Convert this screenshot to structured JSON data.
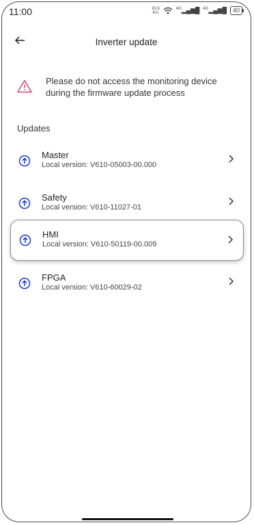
{
  "status_bar": {
    "time": "11:00",
    "net_speed_top": "30.6",
    "net_speed_bottom": "K/s",
    "signal1": "4G",
    "signal2": "4G",
    "battery": "40"
  },
  "header": {
    "title": "Inverter update",
    "back_icon": "arrow-left-icon"
  },
  "warning": {
    "icon": "warning-triangle-icon",
    "line1": "Please do not access the monitoring device",
    "line2": "during the firmware update process",
    "color": "#e0245e"
  },
  "updates": {
    "section_label": "Updates",
    "accent": "#1a3bd6",
    "items": [
      {
        "name": "Master",
        "version": "Local version: V610-05003-00.000"
      },
      {
        "name": "Safety",
        "version": "Local version: V610-11027-01"
      },
      {
        "name": "HMI",
        "version": "Local version: V610-50119-00.009"
      },
      {
        "name": "FPGA",
        "version": "Local version: V610-60029-02"
      }
    ]
  }
}
